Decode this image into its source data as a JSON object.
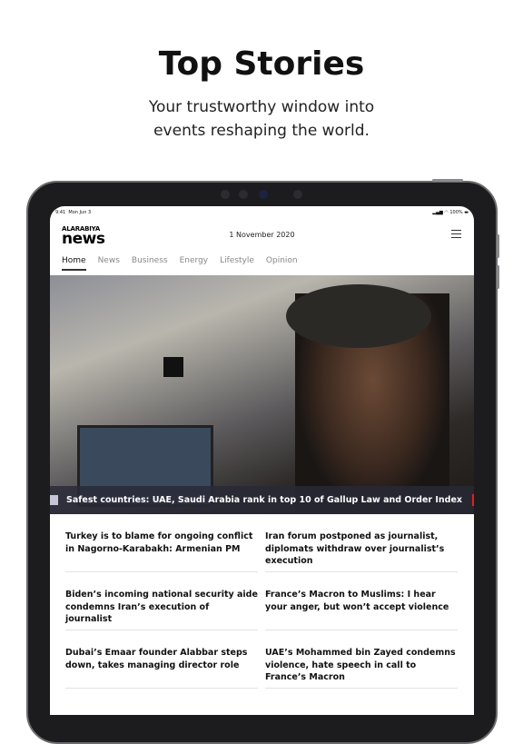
{
  "promo": {
    "title": "Top Stories",
    "subtitle_line1": "Your trustworthy window into",
    "subtitle_line2": "events reshaping the world."
  },
  "status": {
    "time": "9:41",
    "date": "Mon Jun 3",
    "battery": "100%"
  },
  "header": {
    "logo_top": "ALARABIYA",
    "logo_bottom": "news",
    "date": "1 November 2020"
  },
  "tabs": [
    {
      "label": "Home",
      "active": true
    },
    {
      "label": "News"
    },
    {
      "label": "Business"
    },
    {
      "label": "Energy"
    },
    {
      "label": "Lifestyle"
    },
    {
      "label": "Opinion"
    }
  ],
  "hero": {
    "caption": "Safest countries: UAE, Saudi Arabia rank in top 10 of Gallup Law and Order Index",
    "accent": "#e1201f"
  },
  "articles": [
    "Turkey is to blame for ongoing conflict in Nagorno-Karabakh: Armenian PM",
    "Iran forum postponed as journalist, diplomats withdraw over journalist’s execution",
    "Biden’s incoming national security aide condemns Iran’s execution of journalist",
    "France’s Macron to Muslims: I hear your anger, but won’t accept violence",
    "Dubai’s Emaar founder Alabbar steps down, takes managing director role",
    "UAE’s Mohammed bin Zayed condemns violence, hate speech in call to France’s Macron"
  ]
}
